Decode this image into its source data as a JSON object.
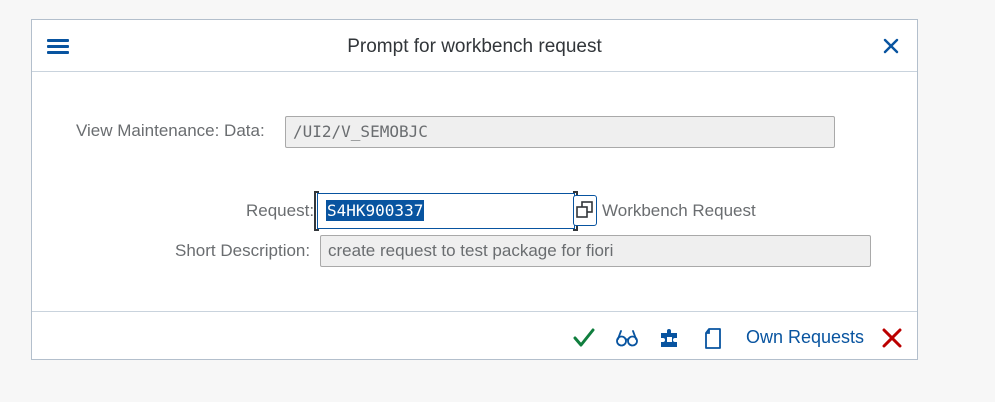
{
  "dialog": {
    "title": "Prompt for workbench request"
  },
  "fields": {
    "view_maintenance_label": "View Maintenance: Data:",
    "view_maintenance_value": "/UI2/V_SEMOBJC",
    "request_label": "Request:",
    "request_value": "S4HK900337",
    "request_type": "Workbench Request",
    "short_description_label": "Short Description:",
    "short_description_value": "create request to test package for fiori"
  },
  "footer": {
    "own_requests_label": "Own Requests"
  },
  "icons": {
    "menu": "menu-icon",
    "close": "close-icon",
    "value_help": "value-help-icon",
    "confirm": "checkmark-icon",
    "display": "glasses-icon",
    "create": "puzzle-icon",
    "new": "document-icon",
    "cancel": "cancel-icon"
  },
  "colors": {
    "accent": "#0854a0",
    "confirm": "#107e3e",
    "cancel": "#bb0000"
  }
}
